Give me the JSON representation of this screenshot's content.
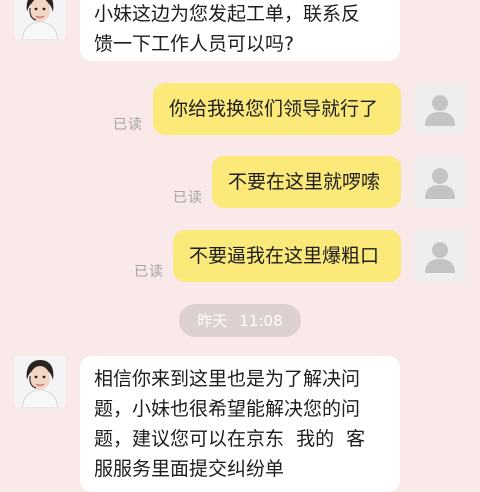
{
  "messages": [
    {
      "sender": "agent",
      "lines": [
        "小妹这边为您发起工单，联系反",
        "馈一下工作人员可以吗?"
      ]
    },
    {
      "sender": "user",
      "text": "你给我换您们领导就行了",
      "status": "已读"
    },
    {
      "sender": "user",
      "text": "不要在这里就啰嗦",
      "status": "已读"
    },
    {
      "sender": "user",
      "text": "不要逼我在这里爆粗口",
      "status": "已读"
    },
    {
      "sender": "agent",
      "lines": [
        "相信你来到这里也是为了解决问",
        "题，小妹也很希望能解决您的问",
        "题，建议您可以在京东  我的  客",
        "服服务里面提交纠纷单"
      ]
    }
  ],
  "timestamp": {
    "day": "昨天",
    "time": "11:08"
  },
  "colors": {
    "background": "#f9e9e9",
    "agent_bubble": "#ffffff",
    "user_bubble": "#fbe97a",
    "read_status": "#a3a3a3"
  },
  "icons": {
    "agent_avatar": "agent-avatar-icon",
    "user_avatar": "default-user-avatar-icon"
  }
}
